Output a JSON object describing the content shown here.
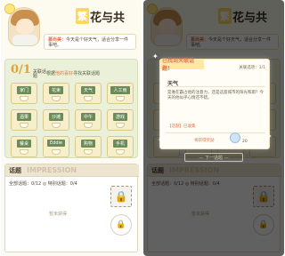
{
  "game": {
    "title_first": "繁",
    "title_rest": "花与共"
  },
  "speech": {
    "speaker": "慕尚美",
    "text": "：今天是个好天气，适合分享一件事吧。"
  },
  "topic": {
    "count": "0/1",
    "count_label": "关联话题",
    "hint_pre": "根据",
    "hint_highlight": "他的喜好",
    "hint_post": "寻找关联话题",
    "tiles": [
      "家门",
      "花束",
      "天气",
      "人工雨",
      "酒果",
      "沙滩",
      "中午",
      "游戏",
      "餐桌",
      "Eddie",
      "购物",
      "手机"
    ]
  },
  "talk": {
    "title": "话题",
    "watermark": "IMPRESSION",
    "stats": "全部话题：0/12  ◎ 特别话题：0/4",
    "empty": "暂未获得"
  },
  "modal": {
    "tab": "已找到关联话题！",
    "selected": "关联选项：1/1",
    "topic_title": "天气",
    "description": "是谁在霸占他的注意力，还是这座城市的阳光和雨？今天的他似乎心情还不错。",
    "tag": "【话题】已收集",
    "reward_label": "将获得奖励",
    "reward_count": "20",
    "next_label": "— 下一话题 —"
  },
  "colors": {
    "accent_orange": "#e27448",
    "tile_bg": "#f7efc9",
    "tile_label": "#6b8b5a",
    "topic_bg": "#ebf0d9"
  }
}
